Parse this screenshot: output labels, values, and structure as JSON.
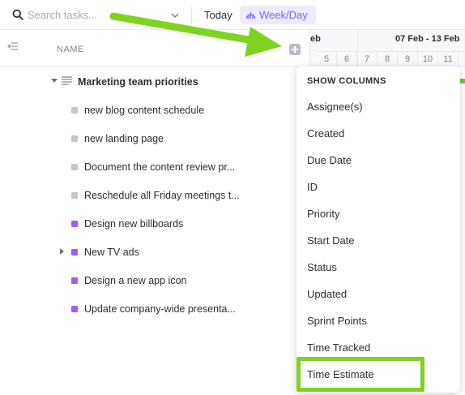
{
  "toolbar": {
    "search_placeholder": "Search tasks...",
    "today_label": "Today",
    "view_label": "Week/Day"
  },
  "list_header": {
    "name_column": "NAME"
  },
  "gantt": {
    "prev_week_fragment": "eb",
    "week_label": "07 Feb - 13 Feb",
    "days": [
      "5",
      "6",
      "7",
      "8",
      "9",
      "10",
      "11"
    ]
  },
  "tasks": {
    "group": "Marketing team priorities",
    "items": [
      {
        "label": "new blog content schedule",
        "status_color": "#c4c6cb"
      },
      {
        "label": "new landing page",
        "status_color": "#c4c6cb"
      },
      {
        "label": "Document the content review pr...",
        "status_color": "#c4c6cb"
      },
      {
        "label": "Reschedule all Friday meetings t...",
        "status_color": "#c4c6cb"
      },
      {
        "label": "Design new billboards",
        "status_color": "#a35cf3"
      },
      {
        "label": "New TV ads",
        "status_color": "#a35cf3"
      },
      {
        "label": "Design a new app icon",
        "status_color": "#a35cf3"
      },
      {
        "label": "Update company-wide presenta...",
        "status_color": "#a35cf3"
      }
    ]
  },
  "show_columns": {
    "title": "SHOW COLUMNS",
    "items": [
      "Assignee(s)",
      "Created",
      "Due Date",
      "ID",
      "Priority",
      "Start Date",
      "Status",
      "Updated",
      "Sprint Points",
      "Time Tracked",
      "Time Estimate"
    ]
  },
  "colors": {
    "accent": "#7b68ee",
    "annotation_green": "#7ed321"
  }
}
